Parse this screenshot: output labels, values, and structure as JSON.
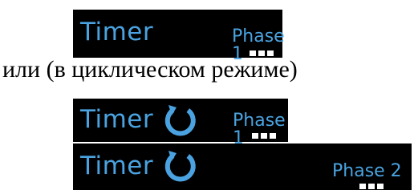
{
  "panel1": {
    "title": "Timer",
    "phase": "Phase 1"
  },
  "caption": "или (в циклическом режиме)",
  "panel2": {
    "title": "Timer",
    "phase": "Phase 1",
    "icon": "cycle-icon"
  },
  "panel3": {
    "title": "Timer",
    "phase": "Phase 2",
    "icon": "cycle-icon"
  },
  "colors": {
    "accent": "#4aa3e0",
    "background": "#000000",
    "dots": "#ffffff"
  }
}
